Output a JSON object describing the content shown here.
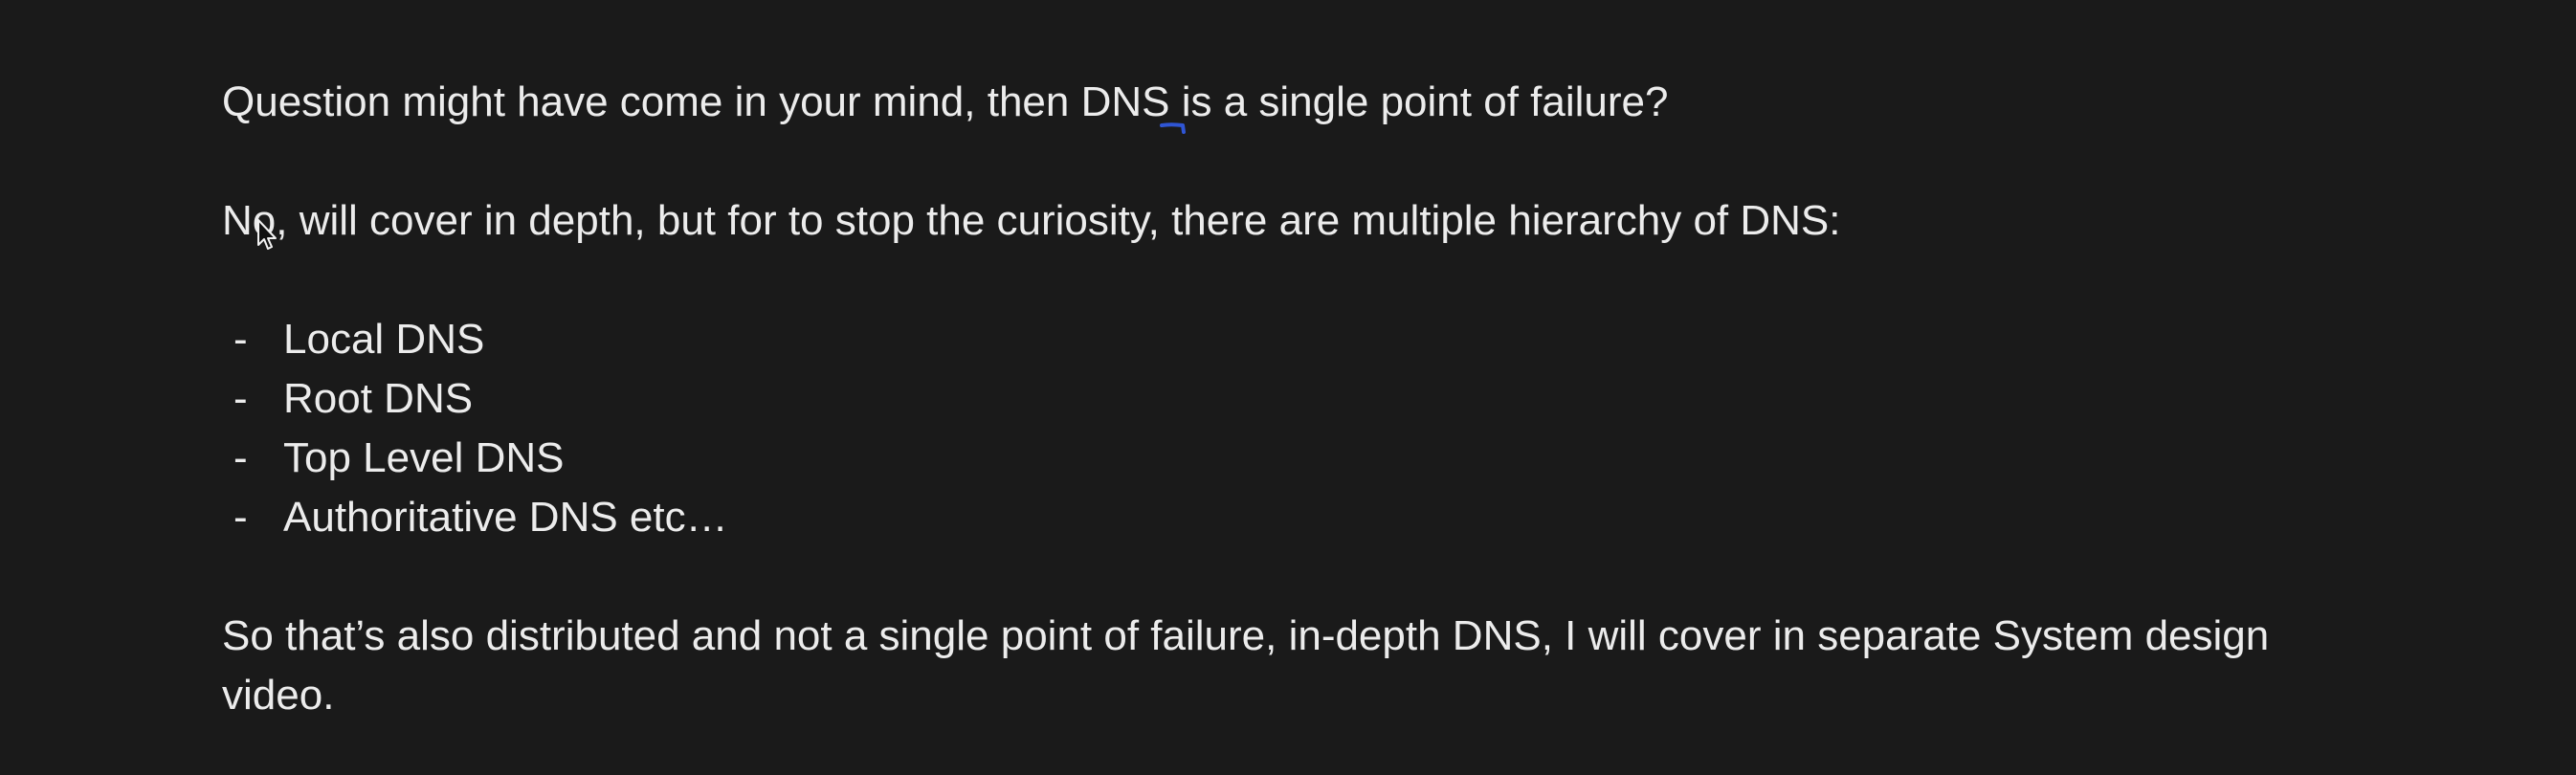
{
  "paragraphs": {
    "question": "Question might have come in your mind, then DNS is a single point of failure?",
    "answer": "No, will cover in depth, but for to stop the curiosity, there are multiple hierarchy of DNS:",
    "conclusion_line1": "So that’s also distributed and not a single point of failure, in-depth DNS, I will cover in separate System design",
    "conclusion_line2": "video."
  },
  "list": {
    "dash": "-",
    "items": [
      "Local DNS",
      "Root DNS",
      "Top Level DNS",
      "Authoritative DNS etc…"
    ]
  },
  "colors": {
    "background": "#1a1a1a",
    "text": "#ececec",
    "annotation": "#2f55d4"
  },
  "icons": {
    "cursor": "mouse-pointer-icon",
    "annotation": "pen-underline-mark"
  }
}
